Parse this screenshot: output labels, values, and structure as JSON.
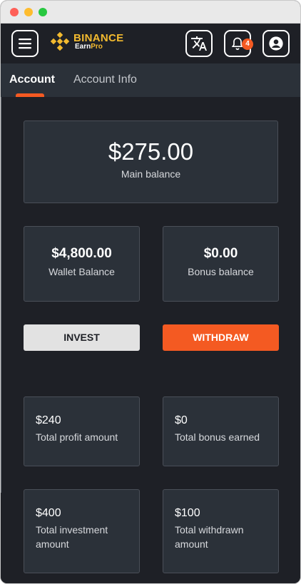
{
  "header": {
    "brand": "BINANCE",
    "sub_brand_1": "Earn",
    "sub_brand_2": "Pro",
    "notification_count": "4",
    "icons": [
      "menu-icon",
      "translate-icon",
      "bell-icon",
      "user-circle-icon"
    ]
  },
  "tabs": [
    {
      "label": "Account",
      "active": true
    },
    {
      "label": "Account Info",
      "active": false
    }
  ],
  "main_balance": {
    "amount": "$275.00",
    "label": "Main balance"
  },
  "wallet_balance": {
    "amount": "$4,800.00",
    "label": "Wallet Balance"
  },
  "bonus_balance": {
    "amount": "$0.00",
    "label": "Bonus balance"
  },
  "actions": {
    "invest": "INVEST",
    "withdraw": "WITHDRAW"
  },
  "stats": [
    {
      "amount": "$240",
      "label": "Total profit amount"
    },
    {
      "amount": "$0",
      "label": "Total bonus earned"
    },
    {
      "amount": "$400",
      "label": "Total investment amount"
    },
    {
      "amount": "$100",
      "label": "Total withdrawn amount"
    }
  ],
  "colors": {
    "accent": "#f45a22",
    "brand": "#f3ba2f",
    "background": "#1e2026",
    "card": "#2b3139"
  }
}
